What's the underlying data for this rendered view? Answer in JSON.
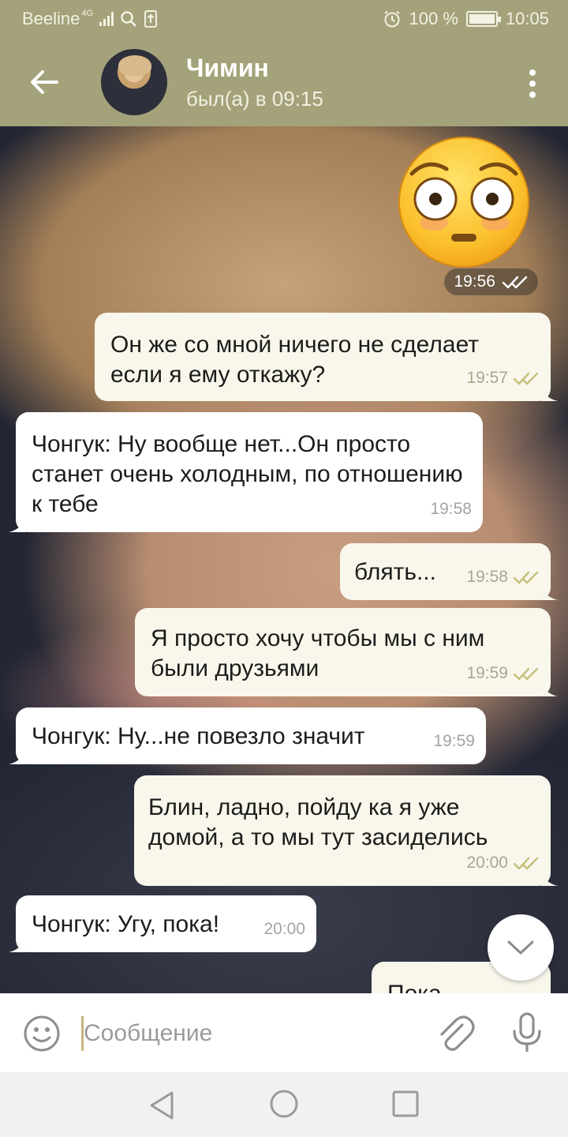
{
  "status_bar": {
    "carrier": "Beeline",
    "network": "4G",
    "battery": "100 %",
    "time": "10:05"
  },
  "header": {
    "contact_name": "Чимин",
    "contact_status": "был(а) в 09:15"
  },
  "sticker": {
    "icon": "flushed-face-emoji-icon",
    "time": "19:56"
  },
  "messages": [
    {
      "direction": "out",
      "text": "Он же со мной ничего не сделает если я ему откажу?",
      "time": "19:57"
    },
    {
      "direction": "in",
      "text": "Чонгук: Ну вообще нет...Он просто станет очень холодным, по отношению к тебе",
      "time": "19:58"
    },
    {
      "direction": "out",
      "text": "блять...",
      "time": "19:58"
    },
    {
      "direction": "out",
      "text": "Я просто хочу чтобы мы с ним были друзьями",
      "time": "19:59"
    },
    {
      "direction": "in",
      "text": "Чонгук: Ну...не повезло значит",
      "time": "19:59"
    },
    {
      "direction": "out",
      "text": "Блин, ладно, пойду ка я уже домой, а то мы тут засиделись",
      "time": "20:00"
    },
    {
      "direction": "in",
      "text": "Чонгук: Угу, пока!",
      "time": "20:00"
    },
    {
      "direction": "out",
      "text": "Пока",
      "time": ""
    }
  ],
  "input": {
    "placeholder": "Сообщение"
  },
  "colors": {
    "header": "#a3a27a",
    "bubble_out": "#f9f7ec",
    "bubble_in": "#ffffff",
    "read_check": "#c5bf7a"
  }
}
